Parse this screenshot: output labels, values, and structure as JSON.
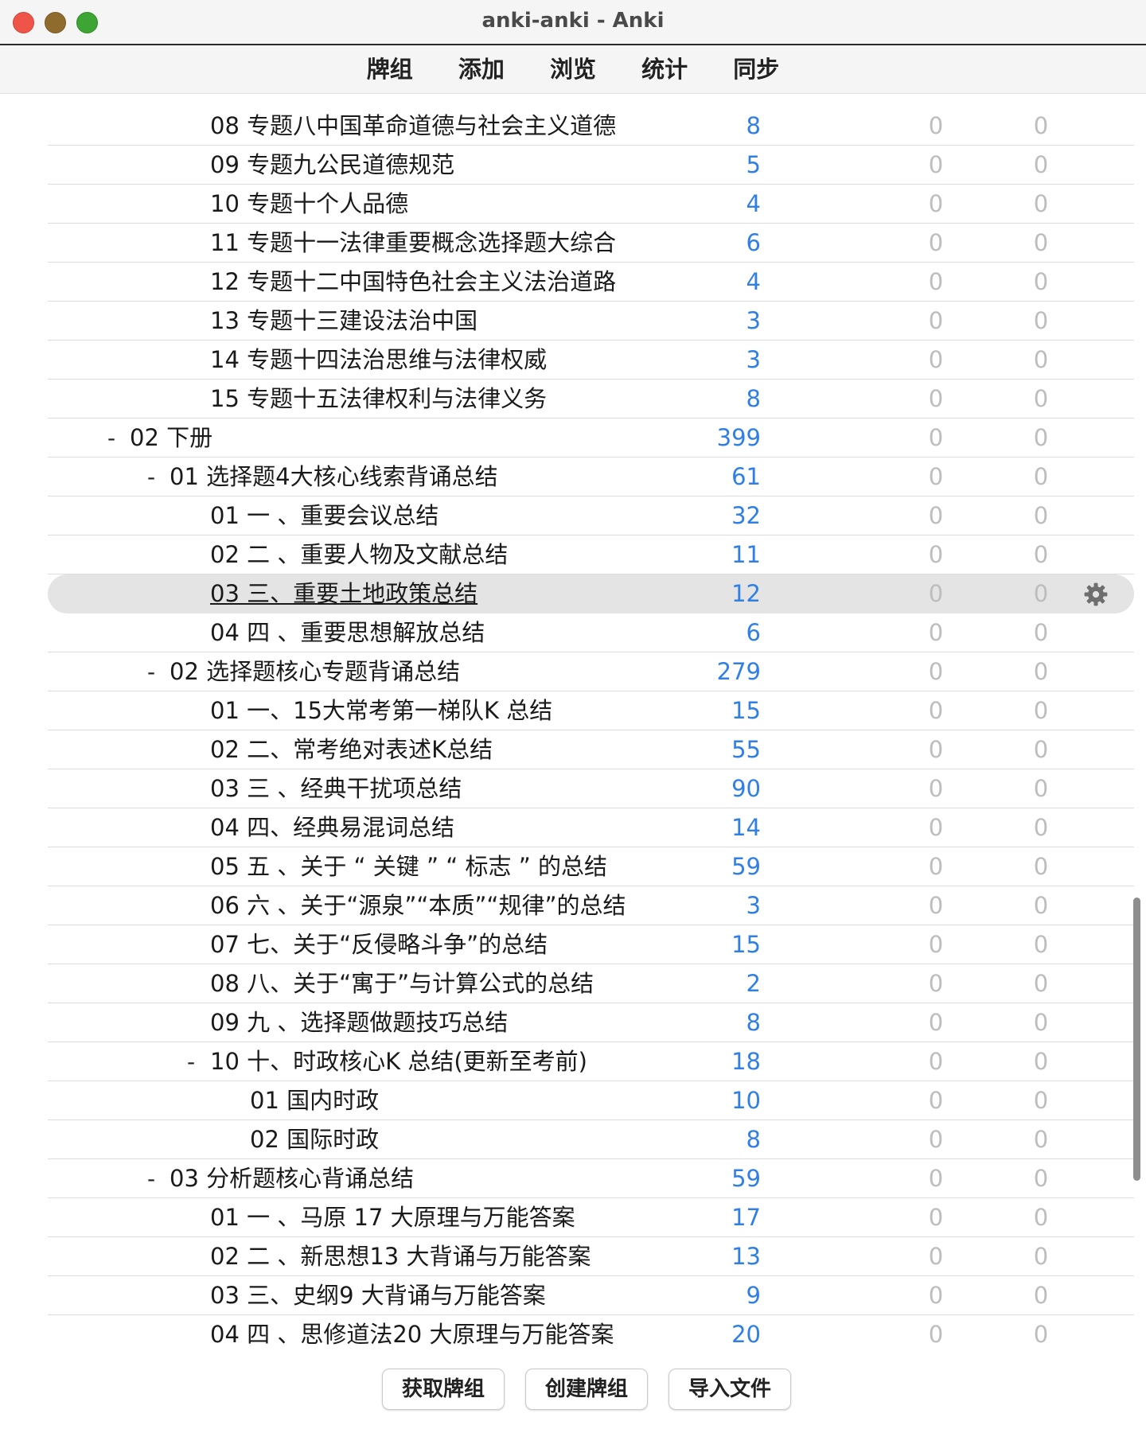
{
  "window": {
    "title": "anki-anki - Anki"
  },
  "toolbar": {
    "items": [
      "牌组",
      "添加",
      "浏览",
      "统计",
      "同步"
    ]
  },
  "deck_list": {
    "rows": [
      {
        "prefix": "",
        "name": "08 专题八中国革命道德与社会主义道德",
        "new": "8",
        "learn": "0",
        "due": "0",
        "depth": 3
      },
      {
        "prefix": "",
        "name": "09 专题九公民道德规范",
        "new": "5",
        "learn": "0",
        "due": "0",
        "depth": 3
      },
      {
        "prefix": "",
        "name": "10 专题十个人品德",
        "new": "4",
        "learn": "0",
        "due": "0",
        "depth": 3
      },
      {
        "prefix": "",
        "name": "11 专题十一法律重要概念选择题大综合",
        "new": "6",
        "learn": "0",
        "due": "0",
        "depth": 3
      },
      {
        "prefix": "",
        "name": "12 专题十二中国特色社会主义法治道路",
        "new": "4",
        "learn": "0",
        "due": "0",
        "depth": 3
      },
      {
        "prefix": "",
        "name": "13 专题十三建设法治中国",
        "new": "3",
        "learn": "0",
        "due": "0",
        "depth": 3
      },
      {
        "prefix": "",
        "name": "14 专题十四法治思维与法律权威",
        "new": "3",
        "learn": "0",
        "due": "0",
        "depth": 3
      },
      {
        "prefix": "",
        "name": "15 专题十五法律权利与法律义务",
        "new": "8",
        "learn": "0",
        "due": "0",
        "depth": 3
      },
      {
        "prefix": "-",
        "name": "02 下册",
        "new": "399",
        "learn": "0",
        "due": "0",
        "depth": 1
      },
      {
        "prefix": "-",
        "name": "01 选择题4大核心线索背诵总结",
        "new": "61",
        "learn": "0",
        "due": "0",
        "depth": 2
      },
      {
        "prefix": "",
        "name": "01 一 、重要会议总结",
        "new": "32",
        "learn": "0",
        "due": "0",
        "depth": 3
      },
      {
        "prefix": "",
        "name": "02 二 、重要人物及文献总结",
        "new": "11",
        "learn": "0",
        "due": "0",
        "depth": 3
      },
      {
        "prefix": "",
        "name": "03 三、重要土地政策总结",
        "new": "12",
        "learn": "0",
        "due": "0",
        "depth": 3,
        "selected": true
      },
      {
        "prefix": "",
        "name": "04 四 、重要思想解放总结",
        "new": "6",
        "learn": "0",
        "due": "0",
        "depth": 3
      },
      {
        "prefix": "-",
        "name": "02 选择题核心专题背诵总结",
        "new": "279",
        "learn": "0",
        "due": "0",
        "depth": 2
      },
      {
        "prefix": "",
        "name": "01 一、15大常考第一梯队K 总结",
        "new": "15",
        "learn": "0",
        "due": "0",
        "depth": 3
      },
      {
        "prefix": "",
        "name": "02 二、常考绝对表述K总结",
        "new": "55",
        "learn": "0",
        "due": "0",
        "depth": 3
      },
      {
        "prefix": "",
        "name": "03 三 、经典干扰项总结",
        "new": "90",
        "learn": "0",
        "due": "0",
        "depth": 3
      },
      {
        "prefix": "",
        "name": "04 四、经典易混词总结",
        "new": "14",
        "learn": "0",
        "due": "0",
        "depth": 3
      },
      {
        "prefix": "",
        "name": "05 五 、关于 “ 关键 ” “ 标志 ” 的总结",
        "new": "59",
        "learn": "0",
        "due": "0",
        "depth": 3
      },
      {
        "prefix": "",
        "name": "06 六 、关于“源泉”“本质”“规律”的总结",
        "new": "3",
        "learn": "0",
        "due": "0",
        "depth": 3
      },
      {
        "prefix": "",
        "name": "07 七、关于“反侵略斗争”的总结",
        "new": "15",
        "learn": "0",
        "due": "0",
        "depth": 3
      },
      {
        "prefix": "",
        "name": "08 八、关于“寓于”与计算公式的总结",
        "new": "2",
        "learn": "0",
        "due": "0",
        "depth": 3
      },
      {
        "prefix": "",
        "name": "09 九 、选择题做题技巧总结",
        "new": "8",
        "learn": "0",
        "due": "0",
        "depth": 3
      },
      {
        "prefix": "-",
        "name": "10 十、时政核心K 总结(更新至考前)",
        "new": "18",
        "learn": "0",
        "due": "0",
        "depth": 3
      },
      {
        "prefix": "",
        "name": "01 国内时政",
        "new": "10",
        "learn": "0",
        "due": "0",
        "depth": 4
      },
      {
        "prefix": "",
        "name": "02 国际时政",
        "new": "8",
        "learn": "0",
        "due": "0",
        "depth": 4
      },
      {
        "prefix": "-",
        "name": "03 分析题核心背诵总结",
        "new": "59",
        "learn": "0",
        "due": "0",
        "depth": 2
      },
      {
        "prefix": "",
        "name": "01 一 、马原 17 大原理与万能答案",
        "new": "17",
        "learn": "0",
        "due": "0",
        "depth": 3
      },
      {
        "prefix": "",
        "name": "02 二 、新思想13 大背诵与万能答案",
        "new": "13",
        "learn": "0",
        "due": "0",
        "depth": 3
      },
      {
        "prefix": "",
        "name": "03 三、史纲9 大背诵与万能答案",
        "new": "9",
        "learn": "0",
        "due": "0",
        "depth": 3
      },
      {
        "prefix": "",
        "name": "04 四 、思修道法20 大原理与万能答案",
        "new": "20",
        "learn": "0",
        "due": "0",
        "depth": 3
      }
    ]
  },
  "buttons": {
    "get_shared": "获取牌组",
    "create_deck": "创建牌组",
    "import_file": "导入文件"
  },
  "colors": {
    "new_count": "#2f7fe6",
    "zero_count": "#bdbdbd",
    "selected_row": "#e4e4e4"
  },
  "icons": {
    "row_options": "gear-icon"
  }
}
